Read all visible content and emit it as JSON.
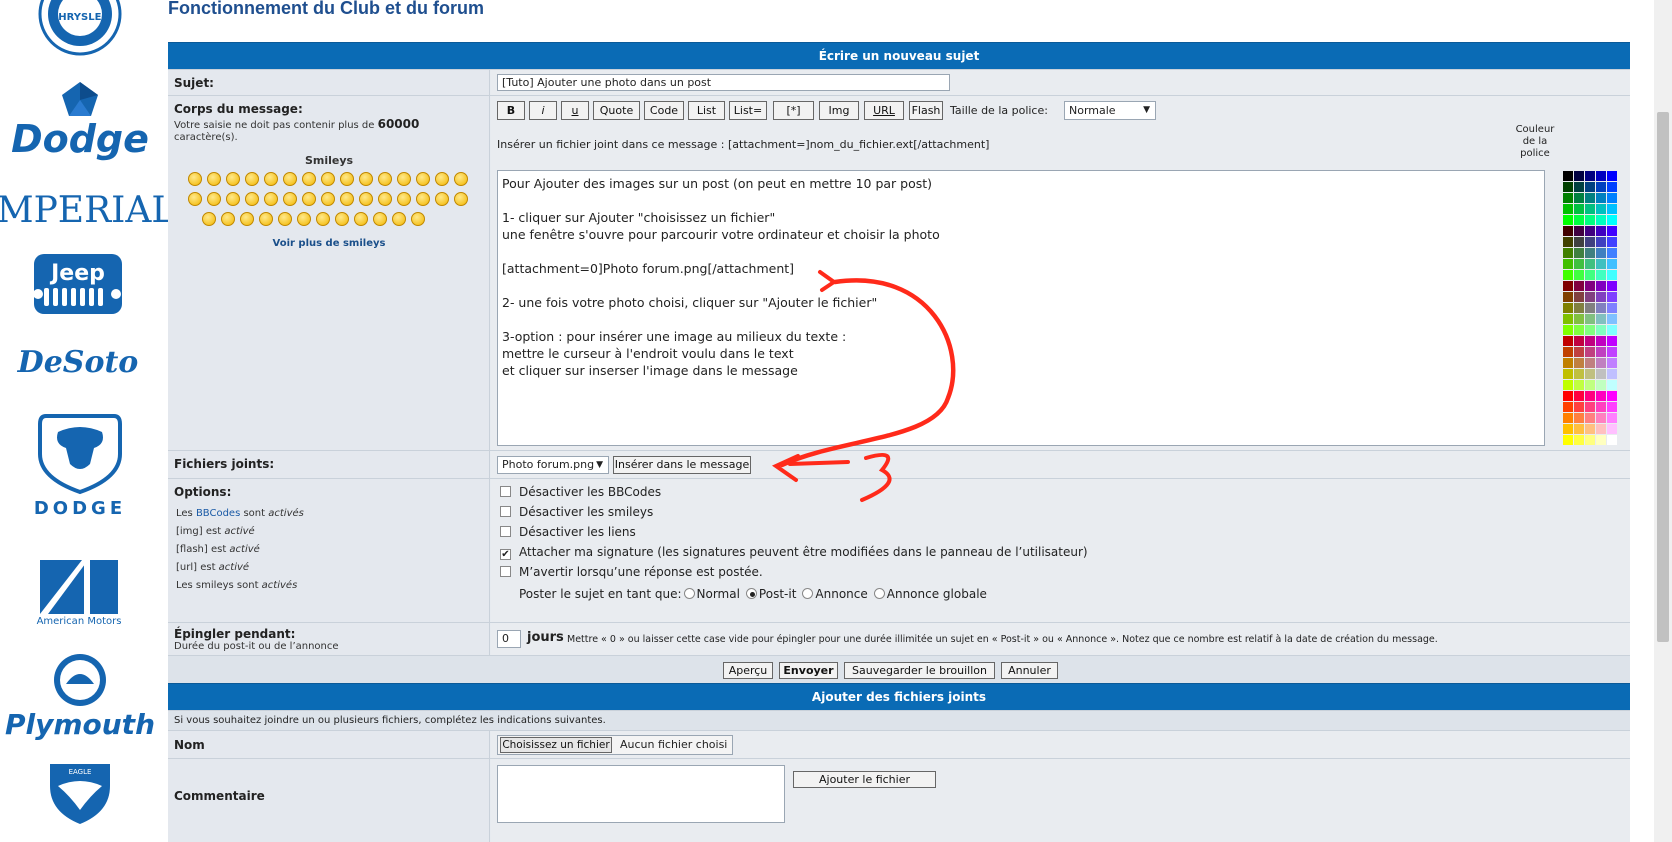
{
  "page_title": "Fonctionnement du Club et du forum",
  "brands": {
    "chrysler": "CHRYSLER",
    "dodge": "Dodge",
    "imperial": "MPERIAL",
    "jeep": "Jeep",
    "desoto": "DeSoto",
    "dodge_ram": "DODGE",
    "american_motors": "American Motors",
    "plymouth": "Plymouth",
    "eagle": "EAGLE"
  },
  "editor": {
    "header": "Écrire un nouveau sujet",
    "subject": {
      "label": "Sujet:",
      "value": "[Tuto] Ajouter une photo dans un post"
    },
    "body": {
      "label": "Corps du message:",
      "note_prefix": "Votre saisie ne doit pas contenir plus de ",
      "note_limit": "60000",
      "note_suffix": " caractère(s).",
      "smileys_title": "Smileys",
      "more_smileys": "Voir plus de smileys"
    },
    "toolbar": {
      "bold": "B",
      "italic": "i",
      "underline": "u",
      "quote": "Quote",
      "code": "Code",
      "list": "List",
      "list_eq": "List=",
      "list_item": "[*]",
      "img": "Img",
      "url": "URL",
      "flash": "Flash",
      "font_size_label": "Taille de la police:",
      "font_size_value": "Normale"
    },
    "attach_hint": "Insérer un fichier joint dans ce message : [attachment=]nom_du_fichier.ext[/attachment]",
    "color_label_1": "Couleur",
    "color_label_2": "de la",
    "color_label_3": "police",
    "message_lines": [
      "Pour Ajouter des images sur un post (on peut en mettre 10 par post)",
      "",
      "1- cliquer sur Ajouter \"choisissez un fichier\"",
      "une fenêtre s'ouvre pour parcourir votre ordinateur et choisir la photo",
      "",
      "[attachment=0]Photo forum.png[/attachment]",
      "",
      "2- une fois votre photo choisi, cliquer sur \"Ajouter le fichier\"",
      "",
      "3-option : pour insérer une image au milieux du texte :",
      "mettre le curseur à l'endroit voulu dans le text",
      "et cliquer sur inserser l'image dans le message"
    ],
    "attachments": {
      "label": "Fichiers joints:",
      "selected": "Photo forum.png",
      "insert_button": "Insérer dans le message"
    },
    "options": {
      "label": "Options:",
      "bbcode_prefix": "Les ",
      "bbcode_link": "BBCodes",
      "bbcode_suffix": " sont ",
      "active": "activés",
      "img_status": "[img] est ",
      "flash_status": "[flash] est ",
      "url_status": "[url] est ",
      "active_single": "activé",
      "smileys_status": "Les smileys sont ",
      "checkboxes": [
        {
          "label": "Désactiver les BBCodes",
          "checked": false
        },
        {
          "label": "Désactiver les smileys",
          "checked": false
        },
        {
          "label": "Désactiver les liens",
          "checked": false
        },
        {
          "label": "Attacher ma signature (les signatures peuvent être modifiées dans le panneau de l’utilisateur)",
          "checked": true
        },
        {
          "label": "M’avertir lorsqu’une réponse est postée.",
          "checked": false
        }
      ],
      "post_type_label": "Poster le sujet en tant que:",
      "post_types": [
        {
          "label": "Normal",
          "selected": false
        },
        {
          "label": "Post-it",
          "selected": true
        },
        {
          "label": "Annonce",
          "selected": false
        },
        {
          "label": "Annonce globale",
          "selected": false
        }
      ]
    },
    "pin": {
      "label": "Épingler pendant:",
      "sub": "Durée du post-it ou de l’annonce",
      "value": "0",
      "unit": "jours",
      "hint": "Mettre « 0 » ou laisser cette case vide pour épingler pour une durée illimitée un sujet en « Post-it » ou « Annonce ». Notez que ce nombre est relatif à la date de création du message."
    },
    "actions": {
      "preview": "Aperçu",
      "submit": "Envoyer",
      "save_draft": "Sauvegarder le brouillon",
      "cancel": "Annuler"
    }
  },
  "attach_section": {
    "header": "Ajouter des fichiers joints",
    "hint": "Si vous souhaitez joindre un ou plusieurs fichiers, complétez les indications suivantes.",
    "name_label": "Nom",
    "choose_button": "Choisissez un fichier",
    "no_file": "Aucun fichier choisi",
    "comment_label": "Commentaire",
    "add_button": "Ajouter le fichier"
  },
  "colors": {
    "header": "#0a6bb5",
    "brand_blue": "#1565b0",
    "annotation": "#ff2a1a"
  }
}
